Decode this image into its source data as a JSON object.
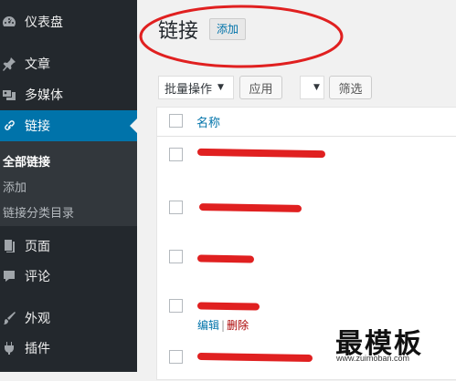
{
  "sidebar": {
    "items": [
      {
        "label": "仪表盘",
        "icon": "dashboard-icon"
      },
      {
        "label": "文章",
        "icon": "pin-icon"
      },
      {
        "label": "多媒体",
        "icon": "media-icon"
      },
      {
        "label": "链接",
        "icon": "link-icon"
      },
      {
        "label": "页面",
        "icon": "page-icon"
      },
      {
        "label": "评论",
        "icon": "comment-icon"
      },
      {
        "label": "外观",
        "icon": "brush-icon"
      },
      {
        "label": "插件",
        "icon": "plugin-icon"
      }
    ],
    "submenu": [
      {
        "label": "全部链接"
      },
      {
        "label": "添加"
      },
      {
        "label": "链接分类目录"
      }
    ]
  },
  "header": {
    "title": "链接",
    "add_label": "添加"
  },
  "toolbar": {
    "bulk_select": "批量操作",
    "apply_label": "应用",
    "filter_label": "筛选"
  },
  "table": {
    "column_name": "名称",
    "row_actions": {
      "edit": "编辑",
      "delete": "删除"
    }
  },
  "watermark": {
    "title": "最模板",
    "url": "www.zuimoban.com"
  },
  "colors": {
    "sidebar_bg": "#23282d",
    "active_bg": "#0073aa",
    "link": "#0073aa",
    "annotation": "#e02020"
  }
}
